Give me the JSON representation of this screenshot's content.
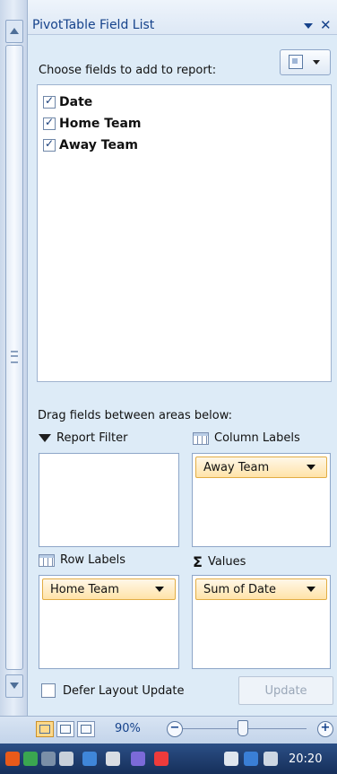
{
  "panel": {
    "title": "PivotTable Field List",
    "choose_label": "Choose fields to add to report:",
    "drag_label": "Drag fields between areas below:"
  },
  "fields": [
    {
      "label": "Date",
      "checked": true
    },
    {
      "label": "Home Team",
      "checked": true
    },
    {
      "label": "Away Team",
      "checked": true
    }
  ],
  "areas": {
    "report_filter": {
      "label": "Report Filter",
      "items": []
    },
    "column_labels": {
      "label": "Column Labels",
      "items": [
        "Away Team"
      ]
    },
    "row_labels": {
      "label": "Row Labels",
      "items": [
        "Home Team"
      ]
    },
    "values": {
      "label": "Values",
      "items": [
        "Sum of Date"
      ]
    }
  },
  "defer": {
    "label": "Defer Layout Update",
    "checked": false
  },
  "update_button": {
    "label": "Update",
    "enabled": false
  },
  "statusbar": {
    "zoom": "90%"
  },
  "taskbar": {
    "clock": "20:20"
  },
  "colors": {
    "accent": "#15428b",
    "panel_bg": "#ddebf7",
    "field_item": "#ffe3a8"
  },
  "icons": [
    "funnel-icon",
    "column-grid-icon",
    "row-grid-icon",
    "sigma-icon"
  ]
}
